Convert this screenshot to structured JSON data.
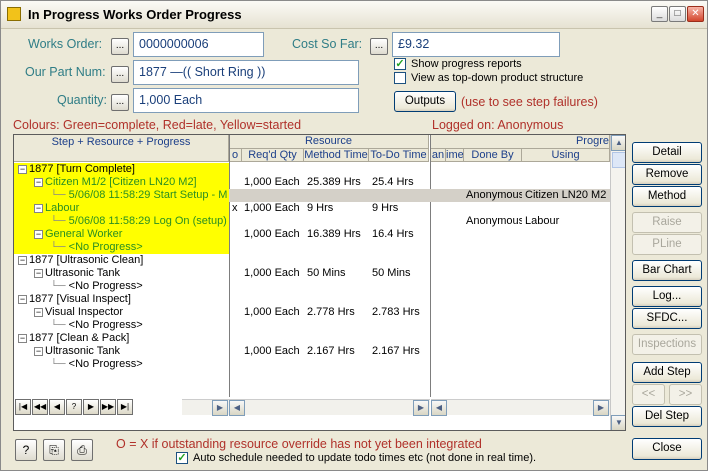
{
  "window": {
    "title": "In Progress Works Order Progress",
    "minimize_glyph": "_",
    "maximize_glyph": "□",
    "close_glyph": "✕"
  },
  "form": {
    "works_order_label": "Works Order:",
    "works_order_value": "0000000006",
    "part_num_label": "Our Part Num:",
    "part_num_value": "1877      —(( Short Ring ))",
    "quantity_label": "Quantity:",
    "quantity_value": "1,000 Each",
    "cost_label": "Cost So Far:",
    "cost_value": "£9.32",
    "ellipsis": "...",
    "show_progress_label": "Show progress reports",
    "show_progress_checked": true,
    "view_topdown_label": "View as top-down product structure",
    "view_topdown_checked": false,
    "outputs_button": "Outputs",
    "outputs_hint": "(use to see step failures)"
  },
  "legend": {
    "colours": "Colours: Green=complete, Red=late, Yellow=started",
    "logged_on": "Logged on: Anonymous"
  },
  "grid": {
    "headers": {
      "tree": "Step + Resource + Progress",
      "resource": "Resource",
      "o": "o",
      "reqd_qty": "Req'd Qty",
      "method_time": "Method Time",
      "todo_time": "To-Do Time",
      "progress": "Progre",
      "an": "an",
      "ime": "ime",
      "done_by": "Done By",
      "using": "Using"
    },
    "rows": [
      {
        "tree": "1877 [Turn Complete]",
        "indent": 0,
        "exp": "−",
        "yellow": true,
        "green": false,
        "o": "",
        "qty": "",
        "method": "",
        "todo": "",
        "done_by": "",
        "using": ""
      },
      {
        "tree": "Citizen M1/2 [Citizen LN20 M2]",
        "indent": 1,
        "exp": "−",
        "yellow": true,
        "green": true,
        "o": "",
        "qty": "1,000 Each",
        "method": "25.389 Hrs",
        "todo": "25.4 Hrs",
        "done_by": "",
        "using": ""
      },
      {
        "tree": "5/06/08 11:58:29 Start Setup - M",
        "indent": 2,
        "exp": "",
        "yellow": true,
        "green": true,
        "selected": true,
        "o": "",
        "qty": "",
        "method": "",
        "todo": "",
        "done_by": "Anonymous",
        "using": "Citizen LN20 M2"
      },
      {
        "tree": "Labour",
        "indent": 1,
        "exp": "−",
        "yellow": true,
        "green": true,
        "o": "x",
        "qty": "1,000 Each",
        "method": "9 Hrs",
        "todo": "9 Hrs",
        "done_by": "",
        "using": ""
      },
      {
        "tree": "5/06/08 11:58:29 Log On (setup)",
        "indent": 2,
        "exp": "",
        "yellow": true,
        "green": true,
        "o": "",
        "qty": "",
        "method": "",
        "todo": "",
        "done_by": "Anonymous",
        "using": "Labour"
      },
      {
        "tree": "General Worker",
        "indent": 1,
        "exp": "−",
        "yellow": true,
        "green": true,
        "o": "",
        "qty": "1,000 Each",
        "method": "16.389 Hrs",
        "todo": "16.4 Hrs",
        "done_by": "",
        "using": ""
      },
      {
        "tree": "<No Progress>",
        "indent": 2,
        "exp": "",
        "yellow": true,
        "green": true,
        "o": "",
        "qty": "",
        "method": "",
        "todo": "",
        "done_by": "",
        "using": ""
      },
      {
        "tree": "1877 [Ultrasonic Clean]",
        "indent": 0,
        "exp": "−",
        "yellow": false,
        "green": false,
        "o": "",
        "qty": "",
        "method": "",
        "todo": "",
        "done_by": "",
        "using": ""
      },
      {
        "tree": "Ultrasonic Tank",
        "indent": 1,
        "exp": "−",
        "yellow": false,
        "green": false,
        "o": "",
        "qty": "1,000 Each",
        "method": "50 Mins",
        "todo": "50 Mins",
        "done_by": "",
        "using": ""
      },
      {
        "tree": "<No Progress>",
        "indent": 2,
        "exp": "",
        "yellow": false,
        "green": false,
        "o": "",
        "qty": "",
        "method": "",
        "todo": "",
        "done_by": "",
        "using": ""
      },
      {
        "tree": "1877 [Visual Inspect]",
        "indent": 0,
        "exp": "−",
        "yellow": false,
        "green": false,
        "o": "",
        "qty": "",
        "method": "",
        "todo": "",
        "done_by": "",
        "using": ""
      },
      {
        "tree": "Visual Inspector",
        "indent": 1,
        "exp": "−",
        "yellow": false,
        "green": false,
        "o": "",
        "qty": "1,000 Each",
        "method": "2.778 Hrs",
        "todo": "2.783 Hrs",
        "done_by": "",
        "using": ""
      },
      {
        "tree": "<No Progress>",
        "indent": 2,
        "exp": "",
        "yellow": false,
        "green": false,
        "o": "",
        "qty": "",
        "method": "",
        "todo": "",
        "done_by": "",
        "using": ""
      },
      {
        "tree": "1877 [Clean & Pack]",
        "indent": 0,
        "exp": "−",
        "yellow": false,
        "green": false,
        "o": "",
        "qty": "",
        "method": "",
        "todo": "",
        "done_by": "",
        "using": ""
      },
      {
        "tree": "Ultrasonic Tank",
        "indent": 1,
        "exp": "−",
        "yellow": false,
        "green": false,
        "o": "",
        "qty": "1,000 Each",
        "method": "2.167 Hrs",
        "todo": "2.167 Hrs",
        "done_by": "",
        "using": ""
      },
      {
        "tree": "<No Progress>",
        "indent": 2,
        "exp": "",
        "yellow": false,
        "green": false,
        "o": "",
        "qty": "",
        "method": "",
        "todo": "",
        "done_by": "",
        "using": ""
      }
    ],
    "nav_buttons": [
      "|◀",
      "◀◀",
      "◀",
      "?",
      "▶",
      "▶▶",
      "▶|"
    ]
  },
  "side_buttons": [
    {
      "label": "Detail",
      "enabled": true,
      "name": "detail-button"
    },
    {
      "label": "Remove",
      "enabled": true,
      "name": "remove-button"
    },
    {
      "label": "Method",
      "enabled": true,
      "name": "method-button"
    },
    {
      "label": "Raise",
      "enabled": false,
      "name": "raise-button"
    },
    {
      "label": "PLine",
      "enabled": false,
      "name": "pline-button"
    },
    {
      "label": "Bar Chart",
      "enabled": true,
      "name": "bar-chart-button"
    },
    {
      "label": "Log...",
      "enabled": true,
      "name": "log-button"
    },
    {
      "label": "SFDC...",
      "enabled": true,
      "name": "sfdc-button"
    },
    {
      "label": "Inspections",
      "enabled": false,
      "name": "inspections-button"
    },
    {
      "label": "Add Step",
      "enabled": true,
      "name": "add-step-button"
    },
    {
      "label": "<<",
      "enabled": false,
      "name": "move-left-button"
    },
    {
      "label": ">>",
      "enabled": false,
      "name": "move-right-button"
    },
    {
      "label": "Del Step",
      "enabled": true,
      "name": "del-step-button"
    }
  ],
  "footer": {
    "override_note": "O = X if outstanding resource override has not yet been integrated",
    "auto_schedule_label": "Auto schedule needed to update todo times etc (not done in real time).",
    "auto_schedule_checked": true,
    "close_button": "Close",
    "help_glyph": "?",
    "copy_glyph": "⎘",
    "print_glyph": "⎙"
  }
}
